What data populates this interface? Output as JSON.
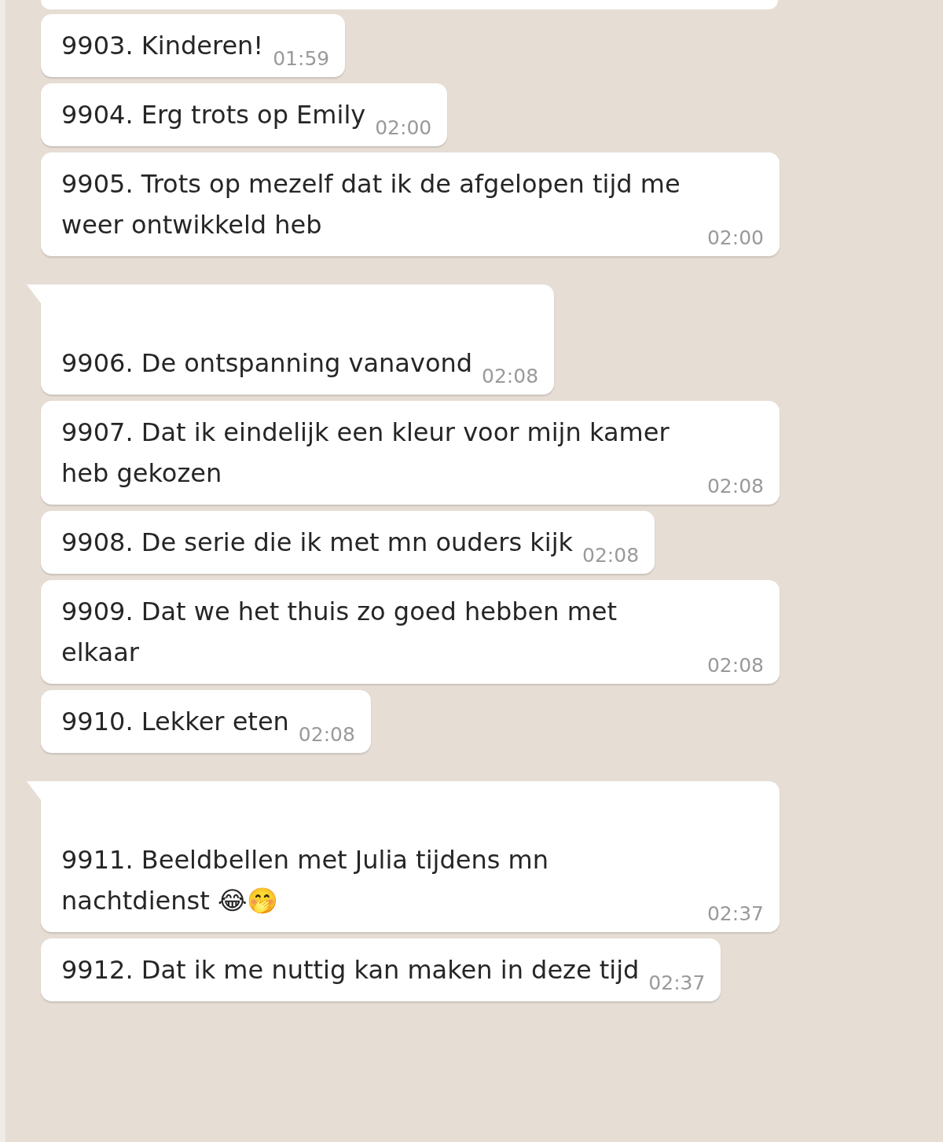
{
  "partial_bubble_above": true,
  "messages": [
    {
      "text": "9903. Kinderen!",
      "time": "01:59",
      "tail": false
    },
    {
      "text": "9904. Erg trots op Emily",
      "time": "02:00",
      "tail": false
    },
    {
      "text": "9905. Trots op mezelf dat ik de afgelopen tijd me weer ontwikkeld heb",
      "time": "02:00",
      "tail": false
    },
    {
      "text": "9906. De ontspanning vanavond",
      "time": "02:08",
      "tail": true
    },
    {
      "text": "9907. Dat ik eindelijk een kleur voor mijn kamer heb gekozen",
      "time": "02:08",
      "tail": false
    },
    {
      "text": "9908. De serie die ik met mn ouders kijk",
      "time": "02:08",
      "tail": false
    },
    {
      "text": "9909. Dat we het thuis zo goed hebben met elkaar",
      "time": "02:08",
      "tail": false
    },
    {
      "text": "9910. Lekker eten",
      "time": "02:08",
      "tail": false
    },
    {
      "text": "9911. Beeldbellen met Julia tijdens mn nachtdienst 😂🤭",
      "time": "02:37",
      "tail": true
    },
    {
      "text": "9912. Dat ik me nuttig kan maken in deze tijd",
      "time": "02:37",
      "tail": false
    }
  ]
}
